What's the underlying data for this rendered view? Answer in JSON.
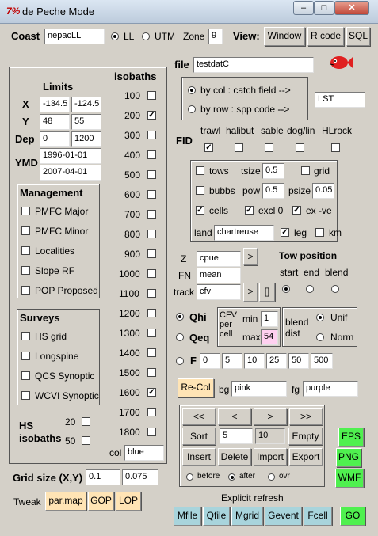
{
  "window": {
    "title": "de Peche Mode",
    "icon_text": "7%"
  },
  "top": {
    "coast_label": "Coast",
    "coast_value": "nepacLL",
    "ll": "LL",
    "utm": "UTM",
    "zone_label": "Zone",
    "zone_value": "9",
    "view_label": "View:",
    "btn_window": "Window",
    "btn_rcode": "R code",
    "btn_sql": "SQL"
  },
  "limits": {
    "title": "Limits",
    "x_label": "X",
    "x_min": "-134.5",
    "x_max": "-124.5",
    "y_label": "Y",
    "y_min": "48",
    "y_max": "55",
    "dep_label": "Dep",
    "dep_min": "0",
    "dep_max": "1200",
    "ymd_label": "YMD",
    "ymd_start": "1996-01-01",
    "ymd_end": "2007-04-01"
  },
  "management": {
    "title": "Management",
    "items": [
      "PMFC Major",
      "PMFC Minor",
      "Localities",
      "Slope RF",
      "POP Proposed"
    ]
  },
  "surveys": {
    "title": "Surveys",
    "items": [
      "HS grid",
      "Longspine",
      "QCS Synoptic",
      "WCVI Synoptic"
    ]
  },
  "hs_isobaths": {
    "label": "HS isobaths",
    "v20": "20",
    "v50": "50"
  },
  "isobaths": {
    "title": "isobaths",
    "values": [
      "100",
      "200",
      "300",
      "400",
      "500",
      "600",
      "700",
      "800",
      "900",
      "1000",
      "1100",
      "1200",
      "1300",
      "1400",
      "1500",
      "1600",
      "1700",
      "1800"
    ],
    "checked": [
      false,
      true,
      false,
      false,
      false,
      false,
      false,
      false,
      false,
      false,
      false,
      false,
      false,
      false,
      false,
      true,
      false,
      false
    ],
    "col_label": "col",
    "col_value": "blue"
  },
  "grid": {
    "label": "Grid size (X,Y)",
    "x": "0.1",
    "y": "0.075"
  },
  "tweak": {
    "label": "Tweak",
    "par_map": "par.map",
    "gop": "GOP",
    "lop": "LOP"
  },
  "file": {
    "label": "file",
    "value": "testdatC",
    "by_col": "by col : catch field  -->",
    "by_row": "by row : spp code   -->",
    "spp_value": "LST"
  },
  "fid": {
    "label": "FID",
    "items": [
      "trawl",
      "halibut",
      "sable",
      "dog/lin",
      "HLrock"
    ],
    "checked": [
      true,
      false,
      false,
      false,
      false
    ]
  },
  "opts": {
    "tows": "tows",
    "tsize_label": "tsize",
    "tsize": "0.5",
    "grid": "grid",
    "bubbs": "bubbs",
    "pow_label": "pow",
    "pow": "0.5",
    "psize_label": "psize",
    "psize": "0.05",
    "cells": "cells",
    "excl0": "excl 0",
    "exve": "ex -ve",
    "land_label": "land",
    "land_value": "chartreuse",
    "leg": "leg",
    "km": "km"
  },
  "zfn": {
    "z_label": "Z",
    "z_value": "cpue",
    "z_btn": ">",
    "fn_label": "FN",
    "fn_value": "mean",
    "track_label": "track",
    "track_value": "cfv",
    "track_btn": ">",
    "track_btn2": "[]"
  },
  "tow": {
    "title": "Tow position",
    "start": "start",
    "end": "end",
    "blend": "blend"
  },
  "q": {
    "qhi": "Qhi",
    "qeq": "Qeq",
    "cfv_label": "CFV per cell",
    "min_label": "min",
    "min_value": "1",
    "max_label": "max",
    "max_value": "54",
    "blend_dist": "blend dist",
    "unif": "Unif",
    "norm": "Norm"
  },
  "f": {
    "label": "F",
    "values": [
      "0",
      "5",
      "10",
      "25",
      "50",
      "500"
    ]
  },
  "recol": {
    "btn": "Re-Col",
    "bg_label": "bg",
    "bg_value": "pink",
    "fg_label": "fg",
    "fg_value": "purple"
  },
  "nav": {
    "first": "<<",
    "prev": "<",
    "next": ">",
    "last": ">>",
    "sort": "Sort",
    "sort_val": "5",
    "count_val": "10",
    "empty": "Empty",
    "insert": "Insert",
    "delete": "Delete",
    "import": "Import",
    "export": "Export",
    "before": "before",
    "after": "after",
    "ovr": "ovr"
  },
  "out": {
    "eps": "EPS",
    "png": "PNG",
    "wmf": "WMF"
  },
  "refresh": {
    "label": "Explicit refresh",
    "mfile": "Mfile",
    "qfile": "Qfile",
    "mgrid": "Mgrid",
    "gevent": "Gevent",
    "fcell": "Fcell",
    "go": "GO"
  },
  "colors": {
    "orange": "#ffe4b5",
    "teal": "#a8d4dc",
    "green": "#4ff04f",
    "max_bg": "#ffd0f0"
  }
}
